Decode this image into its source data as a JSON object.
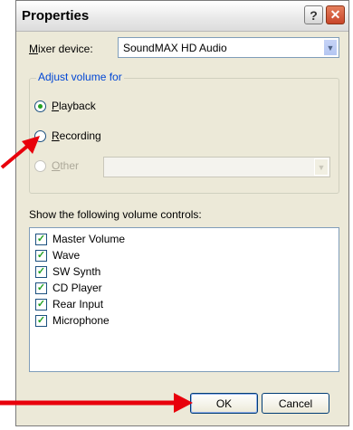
{
  "window": {
    "title": "Properties"
  },
  "titlebar": {
    "help_label": "?",
    "close_label": "✕"
  },
  "mixer": {
    "label_prefix": "",
    "label_u": "M",
    "label_rest": "ixer device:",
    "value": "SoundMAX HD Audio"
  },
  "adjust": {
    "legend": "Adjust volume for",
    "playback": {
      "u": "P",
      "rest": "layback",
      "selected": true
    },
    "recording": {
      "u": "R",
      "rest": "ecording",
      "selected": false
    },
    "other": {
      "u": "O",
      "rest": "ther",
      "selected": false,
      "enabled": false,
      "value": ""
    }
  },
  "controls": {
    "heading": "Show the following volume controls:",
    "items": [
      {
        "label": "Master Volume",
        "checked": true
      },
      {
        "label": "Wave",
        "checked": true
      },
      {
        "label": "SW Synth",
        "checked": true
      },
      {
        "label": "CD Player",
        "checked": true
      },
      {
        "label": "Rear Input",
        "checked": true
      },
      {
        "label": "Microphone",
        "checked": true
      }
    ]
  },
  "buttons": {
    "ok": "OK",
    "cancel": "Cancel"
  },
  "colors": {
    "arrow": "#e8000b",
    "check": "#21a121",
    "legend": "#0046d5"
  }
}
